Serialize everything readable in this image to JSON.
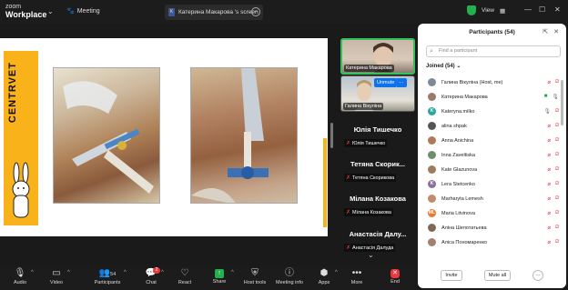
{
  "titlebar": {
    "logo_top": "zoom",
    "logo_bottom": "Workplace",
    "meeting_label": "Meeting",
    "screen_tab": "Катерина Макарова 's screen",
    "view_label": "View"
  },
  "slide": {
    "brand_text": "CENTRVET"
  },
  "strip": {
    "video1_name": "Катерина Макарова",
    "video2_name": "Галина Вікуліна",
    "unmute_label": "Unmute",
    "dots_label": "···",
    "tiles": [
      {
        "name": "Юлія Тишечко",
        "sub": "Юлія Тишечко"
      },
      {
        "name": "Тетяна Скорик...",
        "sub": "Тетяна Скорикова"
      },
      {
        "name": "Мілана Козакова",
        "sub": "Мілана Козакова"
      },
      {
        "name": "Анастасія Далу...",
        "sub": "Анастасія Далуда"
      }
    ]
  },
  "panel": {
    "title": "Participants (54)",
    "search_placeholder": "Find a participant",
    "joined_label": "Joined (54)",
    "participants": [
      {
        "name": "Галина Вікуліна (Host, me)",
        "initial": "",
        "color": "#7a8a99"
      },
      {
        "name": "Катерина Макарова",
        "initial": "",
        "color": "#9a7b6a"
      },
      {
        "name": "Kateryna.milko",
        "initial": "K",
        "color": "#2aa79b"
      },
      {
        "name": "alina shpak",
        "initial": "",
        "color": "#555"
      },
      {
        "name": "Anna Anichina",
        "initial": "",
        "color": "#b07a5a"
      },
      {
        "name": "Inna Zaveltiska",
        "initial": "",
        "color": "#6b8f6a"
      },
      {
        "name": "Kate Glazunova",
        "initial": "",
        "color": "#9c7c5c"
      },
      {
        "name": "Lera Stetcenko",
        "initial": "K",
        "color": "#8b6f9c"
      },
      {
        "name": "Marharyta Lemesh",
        "initial": "",
        "color": "#c28c6c"
      },
      {
        "name": "Maria Litvinova",
        "initial": "ML",
        "color": "#e57a2a"
      },
      {
        "name": "Аліна Шепотатьева",
        "initial": "",
        "color": "#7f6a5a"
      },
      {
        "name": "Аліса Пономаренко",
        "initial": "",
        "color": "#a08070"
      }
    ],
    "invite_label": "Invite",
    "mute_all_label": "Mute all",
    "more_label": "···"
  },
  "toolbar": {
    "audio": "Audio",
    "video": "Video",
    "participants": "Participants",
    "participants_count": "54",
    "chat": "Chat",
    "chat_badge": "2",
    "react": "React",
    "share": "Share",
    "host_tools": "Host tools",
    "meeting_info": "Meeting info",
    "apps": "Apps",
    "more": "More",
    "end": "End"
  }
}
